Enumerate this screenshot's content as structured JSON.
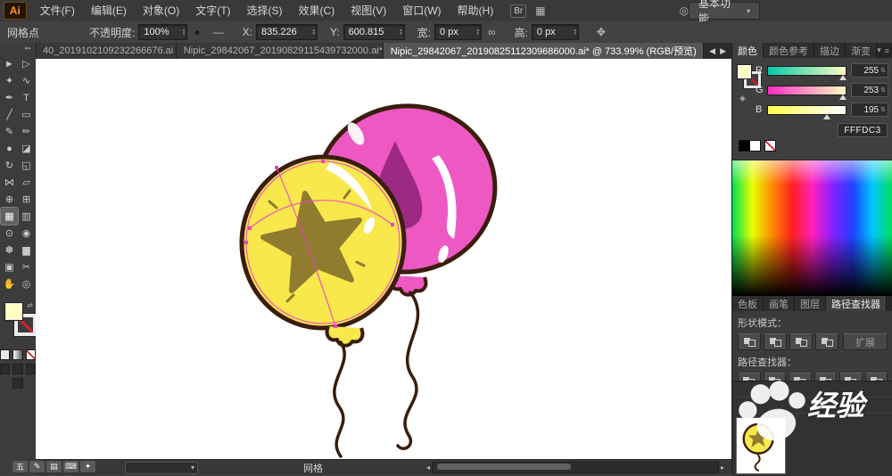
{
  "menubar": {
    "logo": "Ai",
    "items": [
      "文件(F)",
      "编辑(E)",
      "对象(O)",
      "文字(T)",
      "选择(S)",
      "效果(C)",
      "视图(V)",
      "窗口(W)",
      "帮助(H)"
    ],
    "br_badge": "Br",
    "workspace": "基本功能"
  },
  "controlbar": {
    "context_label": "网格点",
    "opacity_label": "不透明度:",
    "opacity_value": "100%",
    "x_label": "X:",
    "x_value": "835.226",
    "y_label": "Y:",
    "y_value": "600.815",
    "width_label": "宽:",
    "width_value": "0 px",
    "height_label": "高:",
    "height_value": "0 px"
  },
  "document_tabs": [
    {
      "label": "40_2019102109232266676.ai",
      "active": false
    },
    {
      "label": "Nipic_29842067_20190829115439732000.ai*",
      "active": false
    },
    {
      "label": "Nipic_29842067_20190825112309686000.ai* @ 733.99% (RGB/预览)",
      "active": true
    }
  ],
  "toolbar": {
    "tools": [
      {
        "name": "selection-tool",
        "glyph": "►"
      },
      {
        "name": "direct-selection-tool",
        "glyph": "▷"
      },
      {
        "name": "magic-wand-tool",
        "glyph": "✦"
      },
      {
        "name": "lasso-tool",
        "glyph": "∿"
      },
      {
        "name": "pen-tool",
        "glyph": "✒"
      },
      {
        "name": "type-tool",
        "glyph": "T"
      },
      {
        "name": "line-segment-tool",
        "glyph": "╱"
      },
      {
        "name": "rectangle-tool",
        "glyph": "▭"
      },
      {
        "name": "paintbrush-tool",
        "glyph": "✎"
      },
      {
        "name": "pencil-tool",
        "glyph": "✏"
      },
      {
        "name": "blob-brush-tool",
        "glyph": "●"
      },
      {
        "name": "eraser-tool",
        "glyph": "◪"
      },
      {
        "name": "rotate-tool",
        "glyph": "↻"
      },
      {
        "name": "scale-tool",
        "glyph": "◱"
      },
      {
        "name": "width-tool",
        "glyph": "⋈"
      },
      {
        "name": "free-transform-tool",
        "glyph": "▱"
      },
      {
        "name": "shape-builder-tool",
        "glyph": "⊕"
      },
      {
        "name": "perspective-grid-tool",
        "glyph": "⊞"
      },
      {
        "name": "mesh-tool",
        "glyph": "▦",
        "selected": true
      },
      {
        "name": "gradient-tool",
        "glyph": "▥"
      },
      {
        "name": "eyedropper-tool",
        "glyph": "⊙"
      },
      {
        "name": "blend-tool",
        "glyph": "◉"
      },
      {
        "name": "symbol-sprayer-tool",
        "glyph": "✽"
      },
      {
        "name": "column-graph-tool",
        "glyph": "▆"
      },
      {
        "name": "artboard-tool",
        "glyph": "▣"
      },
      {
        "name": "slice-tool",
        "glyph": "✂"
      },
      {
        "name": "hand-tool",
        "glyph": "✋"
      },
      {
        "name": "zoom-tool",
        "glyph": "◎"
      }
    ]
  },
  "color_panel": {
    "tabs": [
      {
        "label": "颜色",
        "selected": true
      },
      {
        "label": "颜色参考"
      },
      {
        "label": "描边"
      },
      {
        "label": "渐变"
      }
    ],
    "sliders": [
      {
        "label": "R",
        "value": "255",
        "grad": "r",
        "thumb": "left:97%"
      },
      {
        "label": "G",
        "value": "253",
        "grad": "g",
        "thumb": "left:96%"
      },
      {
        "label": "B",
        "value": "195",
        "grad": "b",
        "thumb": "left:76%"
      }
    ],
    "hex": "FFFDC3"
  },
  "pathfinder_panel": {
    "tabs": [
      {
        "label": "色板"
      },
      {
        "label": "画笔"
      },
      {
        "label": "图层"
      },
      {
        "label": "路径查找器",
        "selected": true
      }
    ],
    "shape_modes_label": "形状模式：",
    "expand_label": "扩展",
    "pathfinder_label": "路径查找器：",
    "shape_mode_buttons": [
      {
        "name": "shape-mode-unite-button"
      },
      {
        "name": "shape-mode-minus-front-button"
      },
      {
        "name": "shape-mode-intersect-button"
      },
      {
        "name": "shape-mode-exclude-button"
      }
    ],
    "pathfinder_buttons": [
      {
        "name": "pathfinder-divide-button"
      },
      {
        "name": "pathfinder-trim-button"
      },
      {
        "name": "pathfinder-merge-button"
      },
      {
        "name": "pathfinder-crop-button"
      },
      {
        "name": "pathfinder-outline-button"
      },
      {
        "name": "pathfinder-minus-back-button"
      }
    ]
  },
  "watermark": {
    "text": "经验"
  },
  "statusbar": {
    "tool_label": "网格"
  },
  "ime": {
    "icons": [
      {
        "name": "ime-wubi-icon",
        "glyph": "五"
      },
      {
        "name": "ime-pen-icon",
        "glyph": "✎"
      },
      {
        "name": "ime-board-icon",
        "glyph": "▤"
      },
      {
        "name": "ime-keyboard-icon",
        "glyph": "⌨"
      },
      {
        "name": "ime-settings-icon",
        "glyph": "✦"
      }
    ]
  },
  "colors": {
    "fill_swatch": "#FFFDC3",
    "balloon_yellow": "#F9E84B",
    "balloon_pink": "#EE58C2",
    "balloon_pink_dark": "#9C2A84",
    "star_olive": "#8F7C2E",
    "outline_brown": "#3A1D0E",
    "selection_magenta": "#EC3FC8"
  }
}
